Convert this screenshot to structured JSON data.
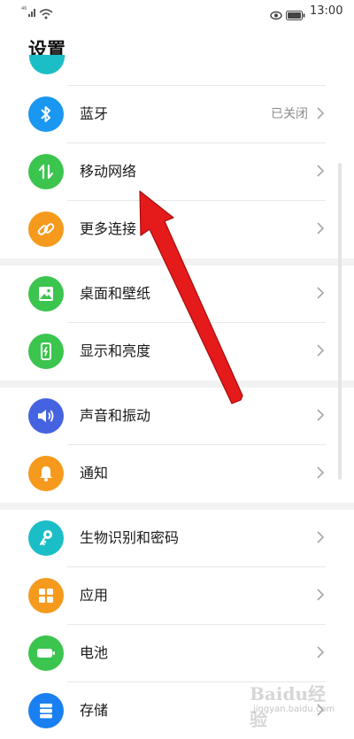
{
  "status": {
    "signal": "46",
    "time": "13:00"
  },
  "title": "设置",
  "items": [
    {
      "label": "蓝牙",
      "value": "已关闭",
      "color": "#1a97f0",
      "icon": "bluetooth-icon"
    },
    {
      "label": "移动网络",
      "value": "",
      "color": "#3bc44e",
      "icon": "mobile-data-icon"
    },
    {
      "label": "更多连接",
      "value": "",
      "color": "#f59a1d",
      "icon": "link-icon"
    },
    {
      "label": "桌面和壁纸",
      "value": "",
      "color": "#3bc44e",
      "icon": "image-icon"
    },
    {
      "label": "显示和亮度",
      "value": "",
      "color": "#3bc44e",
      "icon": "display-brightness-icon"
    },
    {
      "label": "声音和振动",
      "value": "",
      "color": "#4563e0",
      "icon": "sound-icon"
    },
    {
      "label": "通知",
      "value": "",
      "color": "#f59a1d",
      "icon": "bell-icon"
    },
    {
      "label": "生物识别和密码",
      "value": "",
      "color": "#1bbec6",
      "icon": "key-icon"
    },
    {
      "label": "应用",
      "value": "",
      "color": "#f59a1d",
      "icon": "apps-icon"
    },
    {
      "label": "电池",
      "value": "",
      "color": "#3bc44e",
      "icon": "battery-icon"
    },
    {
      "label": "存储",
      "value": "",
      "color": "#1a7ff0",
      "icon": "storage-icon"
    }
  ],
  "watermark": {
    "main": "Baidu经验",
    "sub": "jingyan.baidu.com"
  }
}
